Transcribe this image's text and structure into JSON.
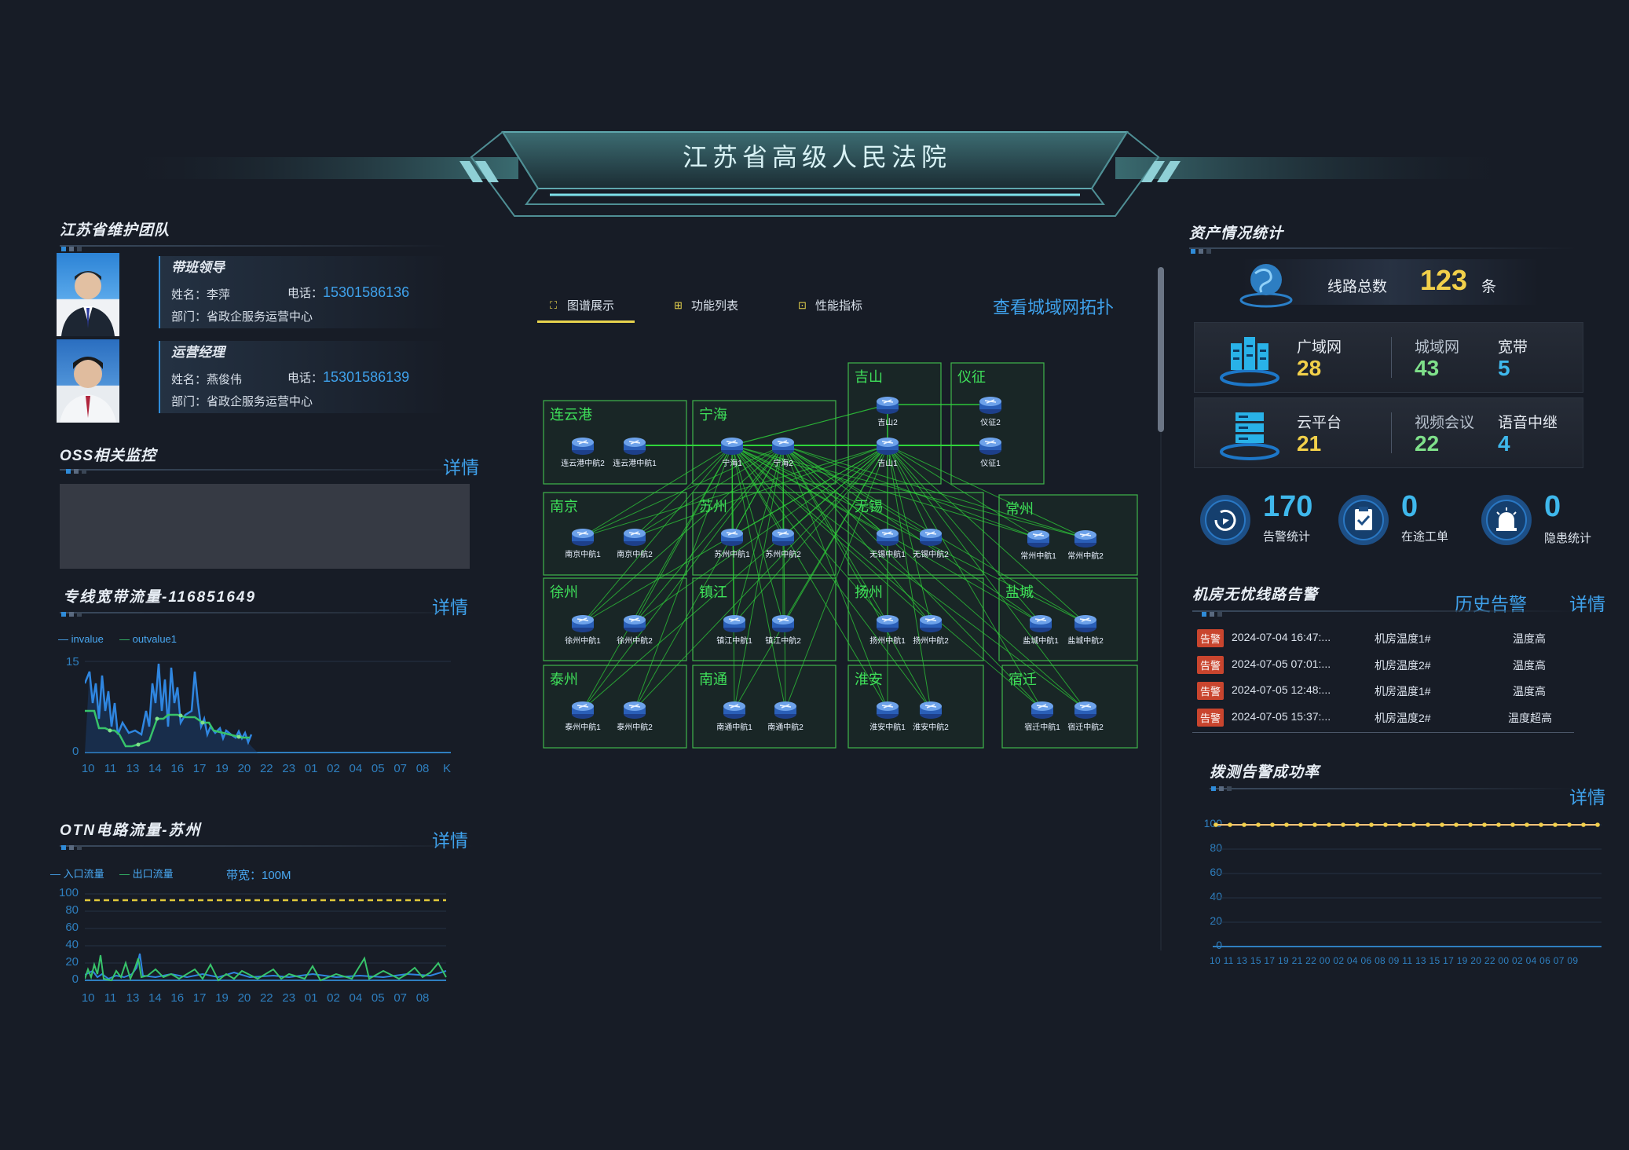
{
  "header": {
    "title": "江苏省高级人民法院"
  },
  "team": {
    "title": "江苏省维护团队",
    "leader": {
      "role": "带班领导",
      "name_label": "姓名：",
      "name": "李萍",
      "phone_label": "电话：",
      "phone": "15301586136",
      "dept_label": "部门：",
      "dept": "省政企服务运营中心"
    },
    "manager": {
      "role": "运营经理",
      "name_label": "姓名：",
      "name": "燕俊伟",
      "phone_label": "电话：",
      "phone": "15301586139",
      "dept_label": "部门：",
      "dept": "省政企服务运营中心"
    }
  },
  "oss": {
    "title": "OSS相关监控",
    "detail": "详情"
  },
  "bandwidth": {
    "title": "专线宽带流量-116851649",
    "detail": "详情",
    "legend": [
      "invalue",
      "outvalue1"
    ],
    "yticks": [
      "15",
      "0"
    ],
    "xticks": [
      "10",
      "11",
      "13",
      "14",
      "16",
      "17",
      "19",
      "20",
      "22",
      "23",
      "01",
      "02",
      "04",
      "05",
      "07",
      "08"
    ],
    "xunit": "K"
  },
  "otn": {
    "title": "OTN电路流量-苏州",
    "detail": "详情",
    "legend": [
      "入口流量",
      "出口流量"
    ],
    "bandwidth_label": "带宽：100M",
    "yticks": [
      "100",
      "80",
      "60",
      "40",
      "20",
      "0"
    ],
    "xticks": [
      "10",
      "11",
      "13",
      "14",
      "16",
      "17",
      "19",
      "20",
      "22",
      "23",
      "01",
      "02",
      "04",
      "05",
      "07",
      "08"
    ]
  },
  "tabs": {
    "items": [
      "图谱展示",
      "功能列表",
      "性能指标"
    ],
    "active": 0,
    "city_topology": "查看城域网拓扑"
  },
  "topology": {
    "regions": [
      {
        "name": "连云港",
        "nodes": [
          "连云港中航2",
          "连云港中航1"
        ]
      },
      {
        "name": "宁海",
        "nodes": [
          "宁海1",
          "宁海2"
        ]
      },
      {
        "name": "吉山",
        "nodes": [
          "吉山2",
          "吉山1"
        ]
      },
      {
        "name": "仪征",
        "nodes": [
          "仪征2",
          "仪征1"
        ]
      },
      {
        "name": "南京",
        "nodes": [
          "南京中航1",
          "南京中航2"
        ]
      },
      {
        "name": "苏州",
        "nodes": [
          "苏州中航1",
          "苏州中航2"
        ]
      },
      {
        "name": "无锡",
        "nodes": [
          "无锡中航1",
          "无锡中航2"
        ]
      },
      {
        "name": "常州",
        "nodes": [
          "常州中航1",
          "常州中航2"
        ]
      },
      {
        "name": "徐州",
        "nodes": [
          "徐州中航1",
          "徐州中航2"
        ]
      },
      {
        "name": "镇江",
        "nodes": [
          "镇江中航1",
          "镇江中航2"
        ]
      },
      {
        "name": "扬州",
        "nodes": [
          "扬州中航1",
          "扬州中航2"
        ]
      },
      {
        "name": "盐城",
        "nodes": [
          "盐城中航1",
          "盐城中航2"
        ]
      },
      {
        "name": "泰州",
        "nodes": [
          "泰州中航1",
          "泰州中航2"
        ]
      },
      {
        "name": "南通",
        "nodes": [
          "南通中航1",
          "南通中航2"
        ]
      },
      {
        "name": "淮安",
        "nodes": [
          "淮安中航1",
          "淮安中航2"
        ]
      },
      {
        "name": "宿迁",
        "nodes": [
          "宿迁中航1",
          "宿迁中航2"
        ]
      }
    ]
  },
  "assets": {
    "title": "资产情况统计",
    "lines_label": "线路总数",
    "lines_value": "123",
    "lines_unit": "条",
    "row1": [
      {
        "label": "广域网",
        "value": "28"
      },
      {
        "label": "城域网",
        "value": "43"
      },
      {
        "label": "宽带",
        "value": "5"
      }
    ],
    "row2": [
      {
        "label": "云平台",
        "value": "21"
      },
      {
        "label": "视频会议",
        "value": "22"
      },
      {
        "label": "语音中继",
        "value": "4"
      }
    ],
    "stats": [
      {
        "value": "170",
        "label": "告警统计"
      },
      {
        "value": "0",
        "label": "在途工单"
      },
      {
        "value": "0",
        "label": "隐患统计"
      }
    ]
  },
  "alarms": {
    "title": "机房无忧线路告警",
    "history": "历史告警",
    "detail": "详情",
    "rows": [
      {
        "badge": "告警",
        "time": "2024-07-04 16:47:...",
        "device": "机房温度1#",
        "type": "温度高"
      },
      {
        "badge": "告警",
        "time": "2024-07-05 07:01:...",
        "device": "机房温度2#",
        "type": "温度高"
      },
      {
        "badge": "告警",
        "time": "2024-07-05 12:48:...",
        "device": "机房温度1#",
        "type": "温度高"
      },
      {
        "badge": "告警",
        "time": "2024-07-05 15:37:...",
        "device": "机房温度2#",
        "type": "温度超高"
      }
    ]
  },
  "probe": {
    "title": "拨测告警成功率",
    "detail": "详情",
    "yticks": [
      "100",
      "80",
      "60",
      "40",
      "20",
      "0"
    ],
    "xticks": "10 11 13 15 17 19 21 22 00 02 04 06 08 09 11 13 15 17 19 20 22 00 02 04 06 07 09"
  },
  "colors": {
    "accent": "#3fa2ec",
    "yellow": "#f2d04a",
    "green": "#7fe08a",
    "region_border": "#3fb54a",
    "link": "#2fd43a"
  }
}
